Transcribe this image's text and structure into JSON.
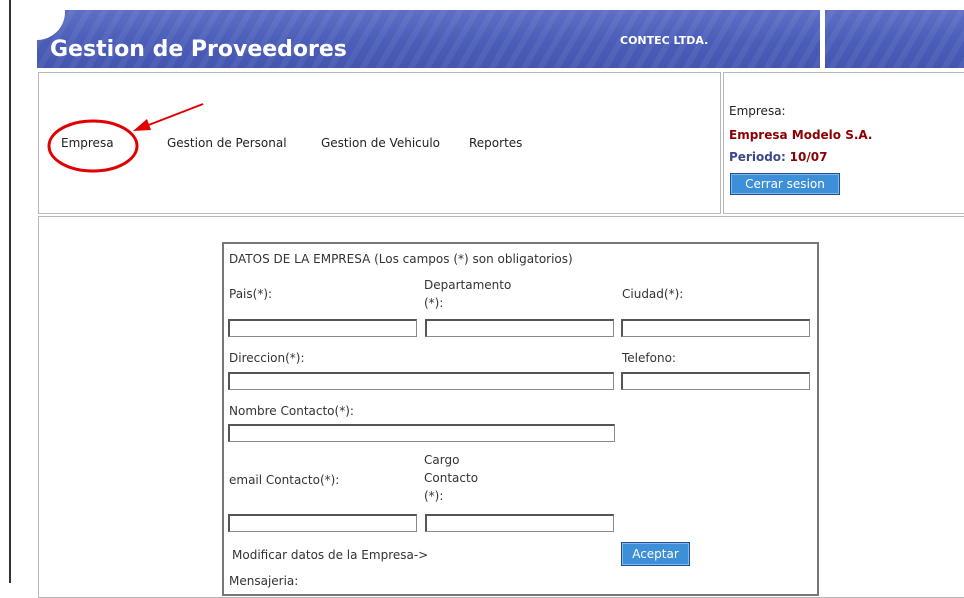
{
  "header": {
    "title": "Gestion de Proveedores",
    "company": "CONTEC LTDA."
  },
  "nav": {
    "items": [
      {
        "label": "Empresa"
      },
      {
        "label": "Gestion de Personal"
      },
      {
        "label": "Gestion de Vehiculo"
      },
      {
        "label": "Reportes"
      }
    ]
  },
  "session": {
    "company_label": "Empresa:",
    "company_name": "Empresa Modelo S.A.",
    "period_label": "Periodo:",
    "period_value": "10/07",
    "logout_label": "Cerrar sesion"
  },
  "form": {
    "title": "DATOS DE LA EMPRESA (Los campos (*) son obligatorios)",
    "pais_label": "Pais(*):",
    "departamento_label_line1": "Departamento",
    "departamento_label_line2": "(*):",
    "ciudad_label": "Ciudad(*):",
    "direccion_label": "Direccion(*):",
    "telefono_label": "Telefono:",
    "nombre_contacto_label": "Nombre Contacto(*):",
    "email_contacto_label": "email Contacto(*):",
    "cargo_label_line1": "Cargo",
    "cargo_label_line2": "Contacto",
    "cargo_label_line3": "(*):",
    "modificar_label": "Modificar datos de la Empresa->",
    "accept_label": "Aceptar",
    "mensajeria_label": "Mensajeria:"
  },
  "colors": {
    "header_blue": "#4a5db8",
    "button_blue": "#3d8fd8",
    "company_name": "#8b0000",
    "annotation_red": "#e00000"
  }
}
